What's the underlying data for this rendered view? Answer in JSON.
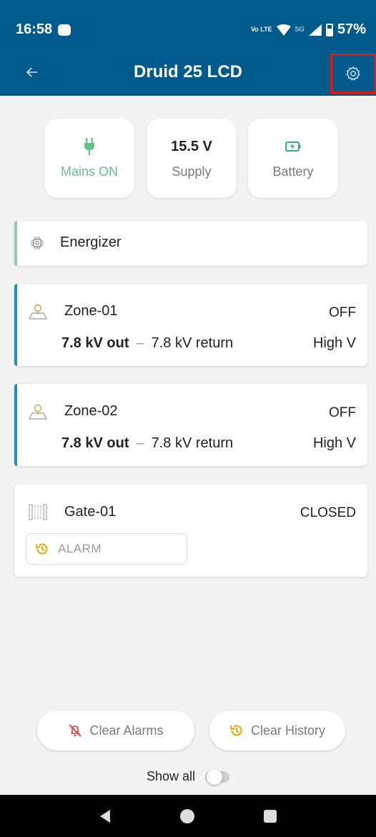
{
  "status_bar": {
    "time": "16:58",
    "network_text": "Vo LTE",
    "network_5g": "5G",
    "battery": "57%"
  },
  "app_bar": {
    "title": "Druid 25 LCD",
    "back_icon": "arrow-left-icon",
    "settings_icon": "gear-icon"
  },
  "tiles": [
    {
      "icon": "plug-icon",
      "value": "",
      "label": "Mains ON",
      "color": "#68c08c"
    },
    {
      "icon": "",
      "value": "15.5 V",
      "label": "Supply",
      "color": "#7b7b7b"
    },
    {
      "icon": "battery-charging-icon",
      "value": "",
      "label": "Battery",
      "color": "#7b7b7b"
    }
  ],
  "energizer": {
    "label": "Energizer",
    "icon": "chip-icon",
    "accent": "#8fd0a8"
  },
  "zones": [
    {
      "name": "Zone-01",
      "state": "OFF",
      "out": "7.8 kV out",
      "separator": "–",
      "return": "7.8 kV return",
      "mode": "High V",
      "icon": "map-pin-icon"
    },
    {
      "name": "Zone-02",
      "state": "OFF",
      "out": "7.8 kV out",
      "separator": "–",
      "return": "7.8 kV return",
      "mode": "High V",
      "icon": "map-pin-icon"
    }
  ],
  "zone_accent": "#1f8fbf",
  "gate": {
    "name": "Gate-01",
    "state": "CLOSED",
    "icon": "gate-icon",
    "alarm_label": "ALARM",
    "alarm_icon": "history-icon"
  },
  "actions": {
    "clear_alarms": "Clear Alarms",
    "clear_history": "Clear History",
    "alarm_icon": "bell-off-icon",
    "history_icon": "history-icon"
  },
  "show_all": {
    "label": "Show all",
    "enabled": false
  },
  "nav": {
    "back": "nav-back-icon",
    "home": "nav-home-icon",
    "recents": "nav-recents-icon"
  }
}
